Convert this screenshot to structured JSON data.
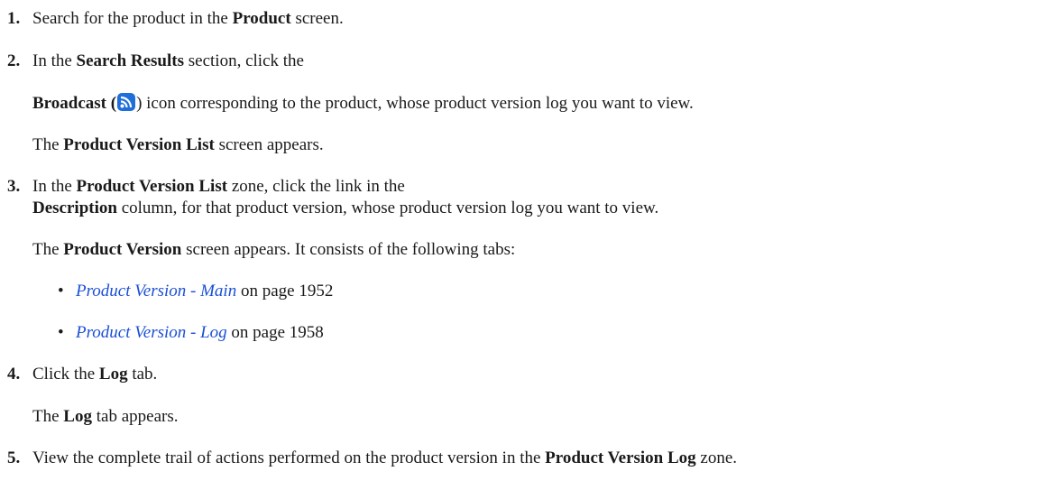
{
  "steps": [
    {
      "num": "1.",
      "pre": "Search for the product in the ",
      "b1": "Product",
      "post": " screen."
    },
    {
      "num": "2.",
      "pre": "In the ",
      "b1": "Search Results",
      "post": " section, click the",
      "cont_b": "Broadcast",
      "cont_open": " (",
      "cont_close": ") icon corresponding to the product, whose product version log you want to view.",
      "result_b": "Product Version List",
      "result_post": " screen appears.",
      "result_pre": "The ",
      "icon": "broadcast-rss-icon"
    },
    {
      "num": "3.",
      "pre": "In the ",
      "b1": "Product Version List",
      "post": " zone, click the link in the",
      "cont_b": "Description",
      "cont_post": " column, for that product version, whose product version log you want to view.",
      "result_pre": "The ",
      "result_b": "Product Version",
      "result_post": " screen appears. It consists of the following tabs:",
      "bullets": [
        {
          "mark": "•",
          "link": "Product Version - Main",
          "post": " on page 1952"
        },
        {
          "mark": "•",
          "link": "Product Version - Log",
          "post": " on page 1958"
        }
      ]
    },
    {
      "num": "4.",
      "pre": "Click the ",
      "b1": "Log",
      "post": " tab.",
      "result_pre": "The ",
      "result_b": "Log",
      "result_post": " tab appears."
    },
    {
      "num": "5.",
      "pre": "View the complete trail of actions performed on the product version in the ",
      "b1": "Product Version Log",
      "post": " zone."
    }
  ],
  "colors": {
    "link": "#1a4fd6",
    "icon_bg": "#1e6fd9"
  }
}
